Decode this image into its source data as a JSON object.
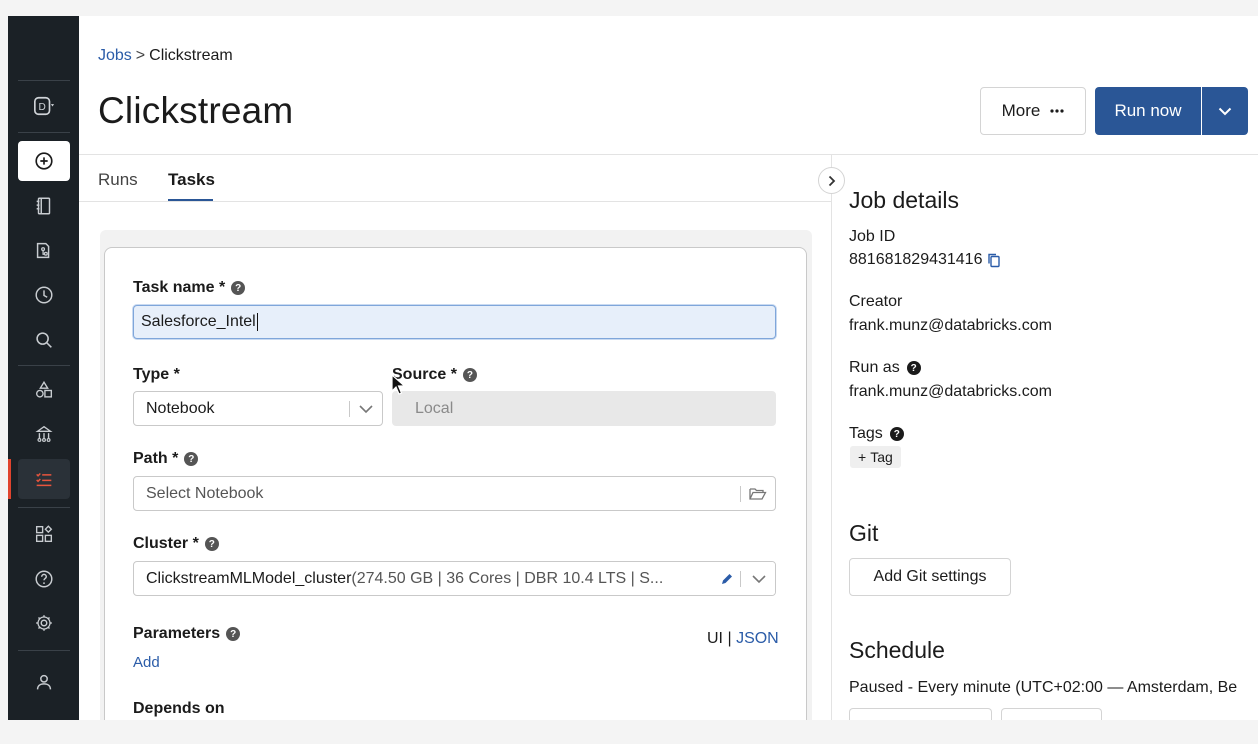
{
  "breadcrumb": {
    "parent": "Jobs",
    "separator": ">",
    "current": "Clickstream"
  },
  "page_title": "Clickstream",
  "header_actions": {
    "more_label": "More",
    "run_now_label": "Run now"
  },
  "tabs": [
    {
      "label": "Runs",
      "active": false
    },
    {
      "label": "Tasks",
      "active": true
    }
  ],
  "task_form": {
    "task_name": {
      "label": "Task name *",
      "value": "Salesforce_Intel"
    },
    "type": {
      "label": "Type *",
      "value": "Notebook"
    },
    "source": {
      "label": "Source *",
      "value": "Local"
    },
    "path": {
      "label": "Path *",
      "placeholder": "Select Notebook"
    },
    "cluster": {
      "label": "Cluster *",
      "name": "ClickstreamMLModel_cluster",
      "details": " (274.50 GB | 36 Cores | DBR 10.4 LTS | S..."
    },
    "parameters": {
      "label": "Parameters",
      "mode_ui": "UI",
      "mode_sep": "|",
      "mode_json": "JSON",
      "add_label": "Add"
    },
    "depends_on": {
      "label": "Depends on"
    }
  },
  "job_details": {
    "title": "Job details",
    "job_id_label": "Job ID",
    "job_id": "881681829431416",
    "creator_label": "Creator",
    "creator": "frank.munz@databricks.com",
    "run_as_label": "Run as",
    "run_as": "frank.munz@databricks.com",
    "tags_label": "Tags",
    "add_tag_label": "Tag",
    "git_title": "Git",
    "git_button": "Add Git settings",
    "schedule_title": "Schedule",
    "schedule_text": "Paused - Every minute (UTC+02:00 — Amsterdam, Be"
  },
  "rail": {
    "workspace_letter": "D"
  },
  "colors": {
    "primary": "#2a5696",
    "link": "#2b5ca8",
    "rail_bg": "#1b2126",
    "rail_accent": "#e0442e"
  }
}
